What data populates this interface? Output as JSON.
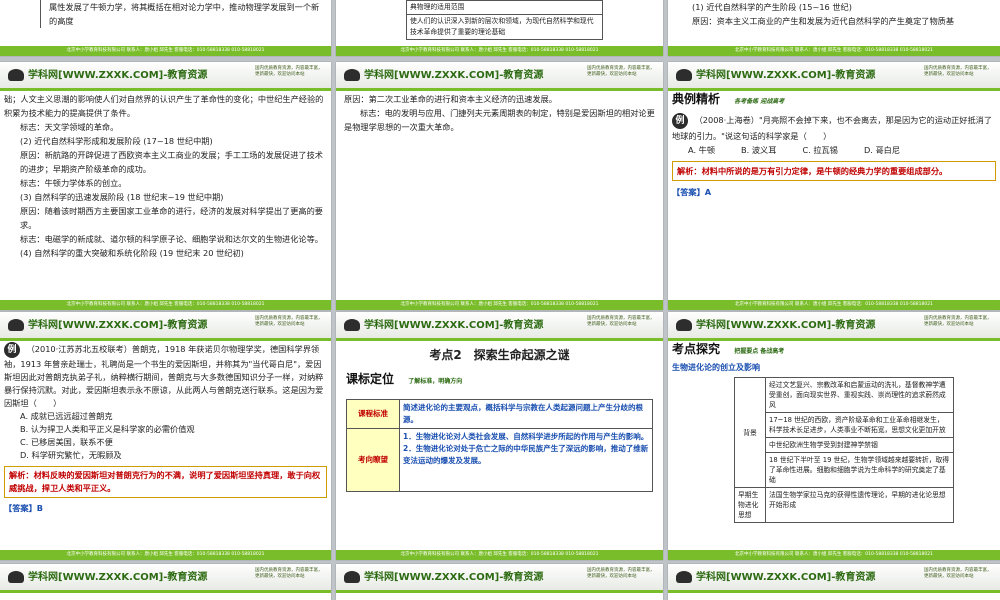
{
  "footer": "北京中小学教育科技有限公司 联系人：唐小姐 邱先生 客服电话：010-58818338 010-58818021",
  "logo_text": "学科网[WWW.ZXXK.COM]-教育资源",
  "promo_text": "国内优质教育资源，内容最丰富，更新最快，欢迎访问本站",
  "slides": {
    "s1": [
      "属性发展了牛顿力学，将其概括在相对论力学中，推动物理学发展到一个新的高度"
    ],
    "s2": [
      "典物理的适用范围",
      "使人们的认识深入到新的层次和领域，为现代自然科学和现代技术革命提供了重要的理论基础"
    ],
    "s3": [
      "(1) 近代自然科学的产生阶段 (15~16 世纪)",
      "原因：资本主义工商业的产生和发展为近代自然科学的产生奠定了物质基"
    ],
    "s4": [
      "础；人文主义思潮的影响使人们对自然界的认识产生了革命性的变化；中世纪生产经验的积累为技术能力的提高提供了条件。",
      "标志：天文学领域的革命。",
      "(2) 近代自然科学形成和发展阶段 (17~18 世纪中期)",
      "原因：新航路的开辟促进了西欧资本主义工商业的发展；手工工场的发展促进了技术的进步；早期资产阶级革命的成功。",
      "标志：牛顿力学体系的创立。",
      "(3) 自然科学的迅速发展阶段 (18 世纪末~19 世纪中期)",
      "原因：随着该时期西方主要国家工业革命的进行，经济的发展对科学提出了更高的要求。",
      "标志：电磁学的新成就、道尔顿的科学原子论、细胞学说和达尔文的生物进化论等。",
      "(4) 自然科学的重大突破和系统化阶段 (19 世纪末 20 世纪初)"
    ],
    "s5": [
      "原因：第二次工业革命的进行和资本主义经济的迅速发展。",
      "标志：电的发明与应用、门捷列夫元素周期表的制定，特别是爱因斯坦的相对论更是物理学思想的一次重大革命。"
    ],
    "s6": {
      "header": "典例精析",
      "sub": "各考备练 迎战高考",
      "q": "（2008·上海卷）\"月亮照不会掉下来，也不会离去，那是因为它的运动正好抵消了地球的引力。\"说这句话的科学家是（　　）",
      "opts": [
        "A. 牛顿",
        "B. 波义耳",
        "C. 拉瓦锡",
        "D. 哥白尼"
      ],
      "analysis": "解析：材料中所说的是万有引力定律，是牛顿的经典力学的重要组成部分。",
      "answer": "【答案】A"
    },
    "s7": {
      "q": "（2010·江苏苏北五校联考）普朗克，1918 年获诺贝尔物理学奖，德国科学界领袖，1913 年曾亲赴瑞士，礼聘尚是一个书生的爱因斯坦，并称其为\"当代哥白尼\"，爱因斯坦因此对普朗克执弟子礼，纳粹横行期间，普朗克与大多数德国知识分子一样，对纳粹暴行保持沉默。对此，爱因斯坦表示永不原谅，从此两人与普朗克送行联系。这是因为爱因斯坦（　　）",
      "opts": [
        "A. 成就已远远超过普朗克",
        "B. 认为捍卫人类和平正义是科学家的必需价值观",
        "C. 已移居美国，联系不便",
        "D. 科学研究繁忙，无暇顾及"
      ],
      "analysis": "解析：材料反映的爱因斯坦对普朗克行为的不满，说明了爱因斯坦坚持真理，敢于向权威挑战，捍卫人类和平正义。",
      "answer": "【答案】B"
    },
    "s8": {
      "title": "考点2　探索生命起源之谜",
      "header": "课标定位",
      "sub": "了解标准，明确方向",
      "rows": [
        {
          "k": "课程标准",
          "v": "简述进化论的主要观点，概括科学与宗教在人类起源问题上产生分歧的根源。"
        },
        {
          "k": "考向瞭望",
          "v": "1．生物进化论对人类社会发展、自然科学进步所起的作用与产生的影响。 2．生物进化论对处于危亡之际的中华民族产生了深远的影响，推动了维新变法运动的爆发及发展。"
        }
      ]
    },
    "s9": {
      "header": "考点探究",
      "sub": "把握要点 备战高考",
      "title": "生物进化论的创立及影响",
      "bg_label": "背景",
      "rows": [
        "经过文艺复兴、宗教改革和启蒙运动的洗礼，基督教神学遭受重创，面向现实世界、重视实践、崇尚理性的追求蔚然成风",
        "17~18 世纪的西欧，资产阶级革命和工业革命相继发生，科学技术长足进步，人类事业不断拓宽，思想文化更加开放",
        "中世纪欧洲生物学受到封建神学禁锢",
        "18 世纪下半叶至 19 世纪，生物学领域越来越要转折，取得了革命性进展。细胞和细胞学说为生命科学的研究奠定了基础"
      ],
      "last_k": "早期生物进化思想",
      "last_v": "法国生物学家拉马克的获得性遗传理论，早期的进化论思想开始形成"
    }
  }
}
